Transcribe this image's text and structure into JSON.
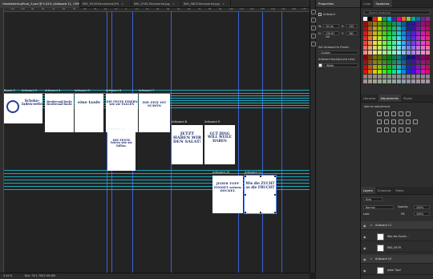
{
  "tabs": [
    {
      "label": "HandletteringFinal_2.psd @ 5.41% (Artboard 11, CMYK/8) *",
      "active": true
    },
    {
      "label": "IMG_9526-Recovered.JPG",
      "active": false
    },
    {
      "label": "IMG_9781-Recovered.jpg",
      "active": false
    },
    {
      "label": "IMG_9803-Recovered.jpg",
      "active": false
    }
  ],
  "ruler_labels": [
    "110",
    "100",
    "90",
    "80",
    "70",
    "60",
    "50",
    "40",
    "30",
    "20",
    "10",
    "0",
    "10",
    "20",
    "30",
    "40",
    "50",
    "60",
    "70",
    "80",
    "90",
    "100",
    "110",
    "120",
    "130",
    "140",
    "150",
    "160",
    "170"
  ],
  "artboards": [
    {
      "label": "Board 2",
      "text": ""
    },
    {
      "label": "Artboard 3",
      "text": "Schoko-laden-seite"
    },
    {
      "label": "Artboard 4",
      "text": "Brotfreund Bockt Brotfreund Bockt"
    },
    {
      "label": "Artboard 5",
      "text": "eine taufe"
    },
    {
      "label": "Artboard 6",
      "text": "DIE FESTE FEIERN wie sie FALLEN"
    },
    {
      "label": "Artboard 7",
      "text": "DIE ZEIT IST SCHÖN"
    },
    {
      "label": "Artboard 12",
      "text": "DIE FESTE feiern wie sie fallen."
    },
    {
      "label": "Artboard 8",
      "text": "JETZT HABEN WIR DEN SALAT!"
    },
    {
      "label": "Artboard 9",
      "text": "GUT DING WILL WEILE HABEN"
    },
    {
      "label": "Artboard 10",
      "text": "JEDER TOPF FINDET seinen DECKEL"
    },
    {
      "label": "Artboard 11",
      "text": "Wie die ZUCHT so die FRUCHT"
    }
  ],
  "status": {
    "zoom": "5.41%",
    "doc": "Doc: 521.7M/2.08.6M"
  },
  "properties": {
    "tab": "Properties",
    "kind": "Artboard",
    "w_label": "W:",
    "w": "19 cm",
    "h_label": "H:",
    "h": "130.67 cm",
    "x_label": "X:",
    "x": "153",
    "y_label": "Y:",
    "y": "281",
    "preset_label": "Set Artboard to Preset:",
    "preset": "Custom",
    "bg_label": "Artboard background color:",
    "bg": "White"
  },
  "color_panel": {
    "tabs": [
      "Color",
      "Swatches"
    ],
    "search_placeholder": "Search Swatches"
  },
  "swatch_colors": [
    "#ffffff",
    "#000000",
    "#e2231a",
    "#f7ec13",
    "#00a651",
    "#00aeef",
    "#2e3192",
    "#ec008c",
    "#f26522",
    "#8dc63f",
    "#00a99d",
    "#0072bc",
    "#662d91",
    "#92278f",
    "#ed145b",
    "#f7941d",
    "#c69c6d",
    "#736357",
    "#a67c52",
    "#603913",
    "#998675",
    "#362f2d",
    "#c2b59b",
    "#8c6239"
  ],
  "adjustments": {
    "tabs": [
      "Libraries",
      "Adjustments",
      "Styles"
    ],
    "hint": "Add an adjustment"
  },
  "layers": {
    "tabs": [
      "Layers",
      "Channels",
      "Paths"
    ],
    "kind_filter": "Kind",
    "blend": "Normal",
    "opacity_label": "Opacity:",
    "opacity": "100%",
    "lock_label": "Lock:",
    "fill_label": "Fill:",
    "fill": "100%",
    "rows": [
      {
        "name": "Artboard 11",
        "type": "group"
      },
      {
        "name": "Wie die Zucht...",
        "type": "layer"
      },
      {
        "name": "IMG_9579",
        "type": "layer"
      },
      {
        "name": "Artboard 10",
        "type": "group"
      },
      {
        "name": "Jeder Topf",
        "type": "layer"
      }
    ]
  }
}
